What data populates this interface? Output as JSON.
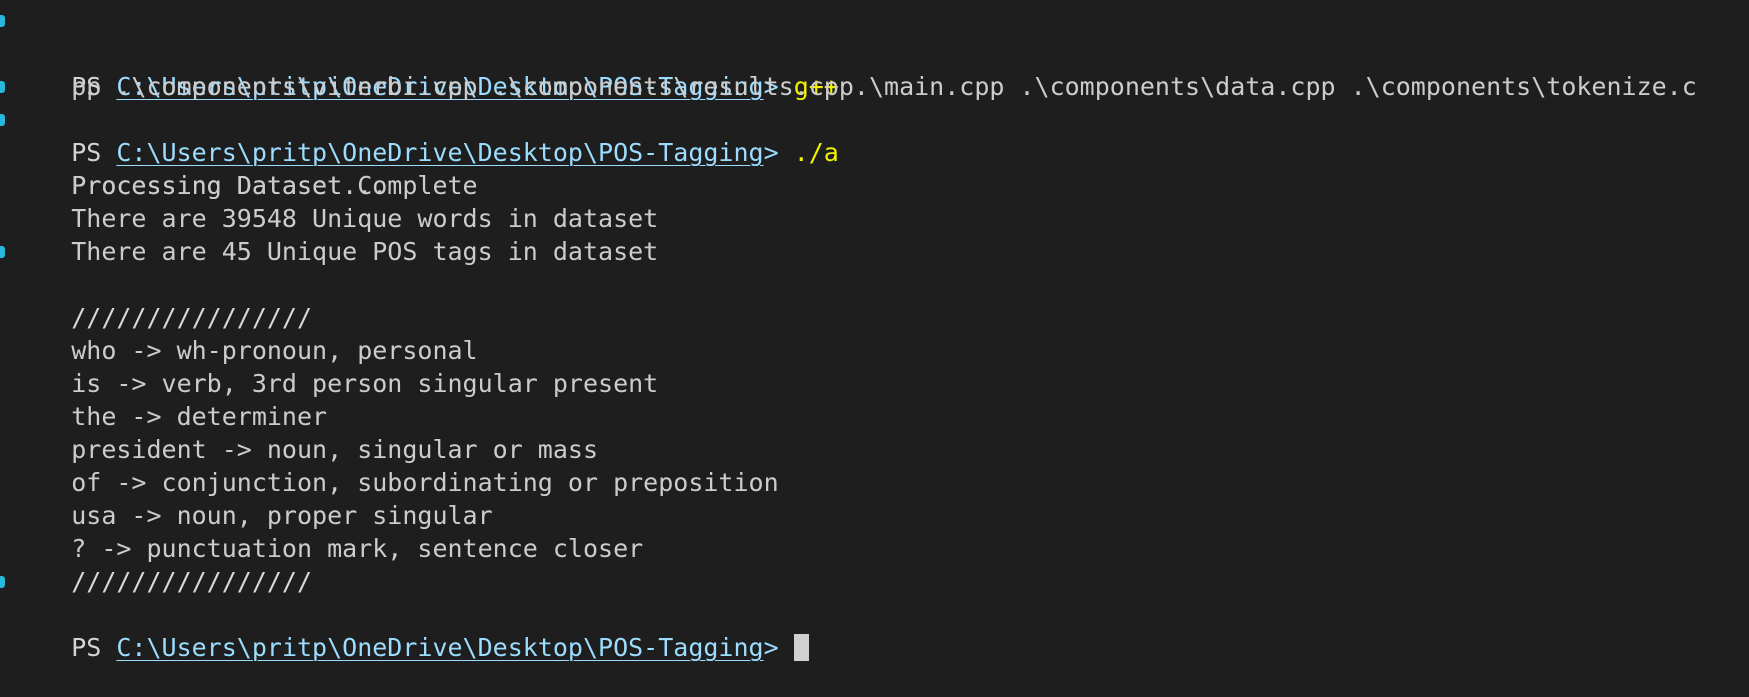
{
  "terminal": {
    "shell": "PowerShell",
    "background_color": "#1e1e1e",
    "foreground_color": "#cccccc",
    "prompt_prefix": "PS ",
    "prompt_path": "C:\\Users\\pritp\\OneDrive\\Desktop\\POS-Tagging",
    "prompt_chevron": ">",
    "colors": {
      "command": "#f2f200",
      "path": "#9cdcfe",
      "output": "#cccccc",
      "gutter_marker": "#29b8db",
      "cursor": "#d0d0d0"
    },
    "lines": [
      {
        "type": "prompt",
        "gutter_marker": true,
        "prefix": "PS ",
        "path": "C:\\Users\\pritp\\OneDrive\\Desktop\\POS-Tagging",
        "chevron": "> ",
        "command": "g++",
        "args": " .\\main.cpp .\\components\\data.cpp .\\components\\tokenize.c"
      },
      {
        "type": "wrap",
        "text": "pp .\\components\\viterbi.cpp .\\components\\results.cpp"
      },
      {
        "type": "prompt",
        "gutter_marker": true,
        "prefix": "PS ",
        "path": "C:\\Users\\pritp\\OneDrive\\Desktop\\POS-Tagging",
        "chevron": "> ",
        "command": "./a",
        "args": ""
      },
      {
        "type": "output",
        "gutter_marker": true,
        "text": "Processing Dataset..."
      },
      {
        "type": "output",
        "text": "Processing Dataset Complete"
      },
      {
        "type": "output",
        "text": "There are 39548 Unique words in dataset"
      },
      {
        "type": "output",
        "text": "There are 45 Unique POS tags in dataset"
      },
      {
        "type": "output",
        "gutter_marker": true,
        "text": ""
      },
      {
        "type": "output",
        "text": "////////////////"
      },
      {
        "type": "output",
        "text": "who -> wh-pronoun, personal"
      },
      {
        "type": "output",
        "text": "is -> verb, 3rd person singular present"
      },
      {
        "type": "output",
        "text": "the -> determiner"
      },
      {
        "type": "output",
        "text": "president -> noun, singular or mass"
      },
      {
        "type": "output",
        "text": "of -> conjunction, subordinating or preposition"
      },
      {
        "type": "output",
        "text": "usa -> noun, proper singular"
      },
      {
        "type": "output",
        "text": "? -> punctuation mark, sentence closer"
      },
      {
        "type": "output",
        "text": "////////////////"
      },
      {
        "type": "prompt",
        "gutter_marker": true,
        "prefix": "PS ",
        "path": "C:\\Users\\pritp\\OneDrive\\Desktop\\POS-Tagging",
        "chevron": "> ",
        "command": "",
        "args": "",
        "cursor": true
      }
    ]
  }
}
